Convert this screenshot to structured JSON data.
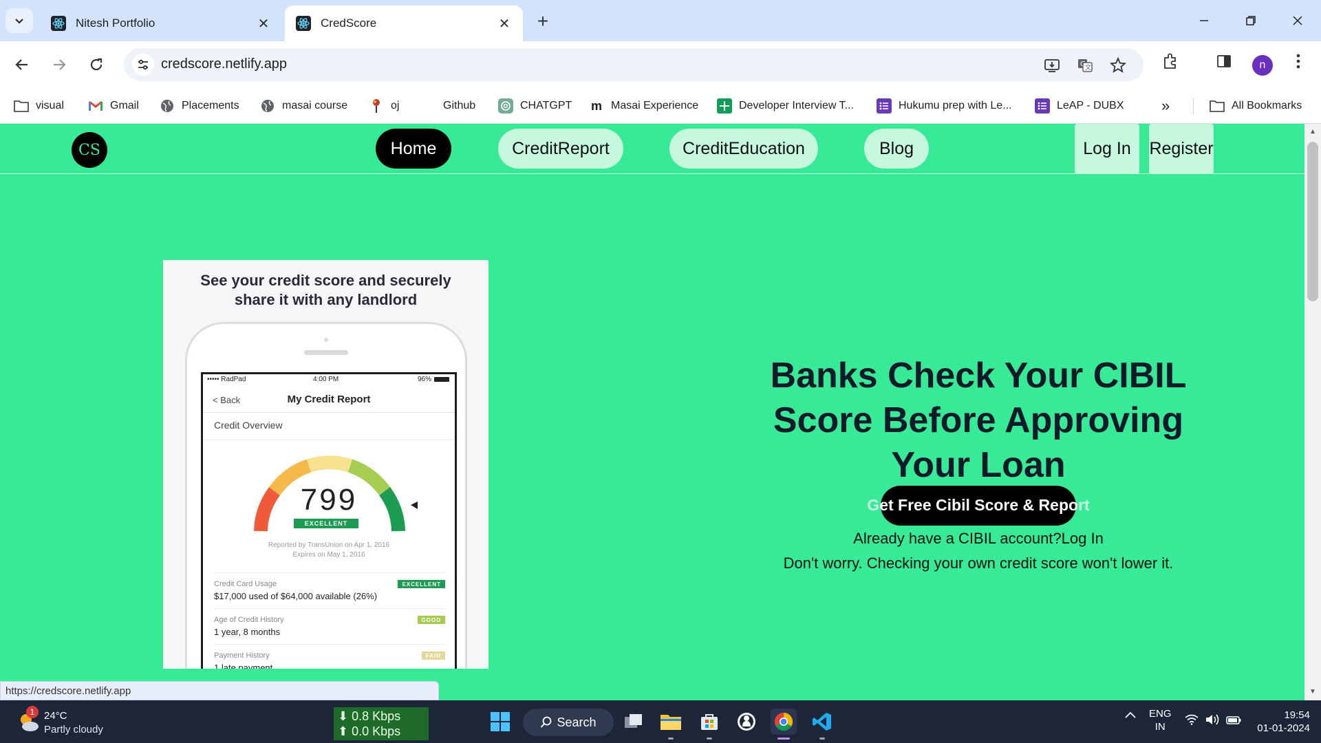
{
  "browser": {
    "tabs": [
      {
        "title": "Nitesh Portfolio",
        "active": false
      },
      {
        "title": "CredScore",
        "active": true
      }
    ],
    "url": "credscore.netlify.app",
    "bookmarks": [
      {
        "label": "visual",
        "icon": "folder-icon"
      },
      {
        "label": "Gmail",
        "icon": "gmail-icon"
      },
      {
        "label": "Placements",
        "icon": "globe-icon"
      },
      {
        "label": "masai course",
        "icon": "globe-icon"
      },
      {
        "label": "oj",
        "icon": "pin-icon"
      },
      {
        "label": "Github",
        "icon": "github-icon"
      },
      {
        "label": "CHATGPT",
        "icon": "chatgpt-icon"
      },
      {
        "label": "Masai Experience",
        "icon": "medium-icon"
      },
      {
        "label": "Developer Interview T...",
        "icon": "sheets-icon"
      },
      {
        "label": "Hukumu prep with Le...",
        "icon": "forms-icon"
      },
      {
        "label": "LeAP - DUBX",
        "icon": "forms-icon"
      }
    ],
    "all_bookmarks": "All Bookmarks",
    "profile_initial": "n",
    "hover_url": "https://credscore.netlify.app"
  },
  "site": {
    "logo": "CS",
    "nav": [
      {
        "label": "Home",
        "active": true
      },
      {
        "label": "CreditReport",
        "active": false
      },
      {
        "label": "CreditEducation",
        "active": false
      },
      {
        "label": "Blog",
        "active": false
      }
    ],
    "login": "Log In",
    "register": "Register",
    "promo": {
      "headline_line1": "See your credit score and securely",
      "headline_line2": "share it with any landlord",
      "carrier": "••••• RadPad",
      "time": "4:00 PM",
      "battery": "96%",
      "back": "< Back",
      "screen_title": "My Credit Report",
      "overview": "Credit Overview",
      "score": "799",
      "score_rating": "EXCELLENT",
      "reported_line1": "Reported by TransUnion on Apr 1, 2016",
      "reported_line2": "Expires on May 1, 2016",
      "metrics": [
        {
          "label": "Credit Card Usage",
          "value": "$17,000 used of $64,000 available (26%)",
          "tag": "EXCELLENT",
          "color": "#1c9c52"
        },
        {
          "label": "Age of Credit History",
          "value": "1 year, 8 months",
          "tag": "GOOD",
          "color": "#a7cc52"
        },
        {
          "label": "Payment History",
          "value": "1 late payment",
          "tag": "FAIR",
          "color": "#e3d79a"
        }
      ]
    },
    "hero": {
      "title_line1": "Banks Check Your CIBIL",
      "title_line2": "Score Before Approving",
      "title_line3": "Your Loan",
      "cta_pre": "G",
      "cta_mid": "et Free Cibil Score & Repo",
      "cta_r": "r",
      "cta_post": "t",
      "already": "Already have a CIBIL account?Log In",
      "reassure": "Don't worry. Checking your own credit score won't lower it."
    },
    "accent": "#37ea96"
  },
  "taskbar": {
    "weather_temp": "24°C",
    "weather_desc": "Partly cloudy",
    "weather_badge": "1",
    "down_speed": "⬇ 0.8 Kbps",
    "up_speed": "⬆ 0.0 Kbps",
    "search": "Search",
    "lang1": "ENG",
    "lang2": "IN",
    "time": "19:54",
    "date": "01-01-2024"
  }
}
